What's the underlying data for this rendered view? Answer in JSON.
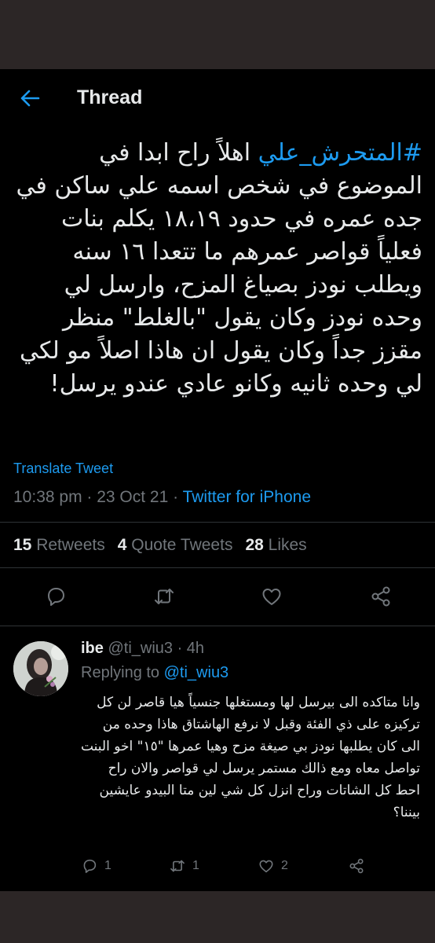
{
  "header": {
    "title": "Thread"
  },
  "tweet": {
    "hashtag": "#المتحرش_علي",
    "text_after_hashtag": " اهلاً راح ابدا في الموضوع في شخص اسمه علي ساكن في جده عمره في حدود ١٨،١٩ يكلم بنات فعلياً قواصر عمرهم ما تتعدا ١٦ سنه ويطلب نودز بصياغ المزح، وارسل لي وحده نودز وكان يقول \"بالغلط\" منظر مقزز جداً وكان يقول ان هاذا اصلاً مو لكي لي وحده ثانيه وكانو عادي عندو يرسل!",
    "translate": "Translate Tweet",
    "time": "10:38 pm",
    "sep1": " · ",
    "date": "23 Oct 21",
    "sep2": " · ",
    "source": "Twitter for iPhone",
    "retweets_count": "15",
    "retweets_label": " Retweets",
    "quotes_count": "4",
    "quotes_label": " Quote Tweets",
    "likes_count": "28",
    "likes_label": " Likes"
  },
  "reply": {
    "name": "ibe",
    "handle": " @ti_wiu3",
    "time": " · 4h",
    "replying_prefix": "Replying to ",
    "replying_to": "@ti_wiu3",
    "text": "وانا متاكده الى بيرسل لها ومستغلها جنسياً هيا قاصر لن كل تركيزه على ذي الفئة وقبل لا نرفع الهاشتاق هاذا وحده من الى كان يطلبها نودز بي صيغة مزح وهيا عمرها \"١٥\" اخو البنت تواصل معاه ومع ذالك مستمر يرسل لي قواصر والان راح احط كل الشاتات وراح انزل كل شي لين متا البيدو عايشين بيننا؟",
    "reply_count": "1",
    "retweet_count": "1",
    "like_count": "2"
  },
  "icons": {
    "back": "back-arrow-icon",
    "reply": "reply-icon",
    "retweet": "retweet-icon",
    "like": "heart-icon",
    "share": "share-icon"
  },
  "colors": {
    "accent": "#1d9bf0",
    "background": "#000000",
    "text": "#e7e9ea",
    "muted": "#71767b"
  }
}
